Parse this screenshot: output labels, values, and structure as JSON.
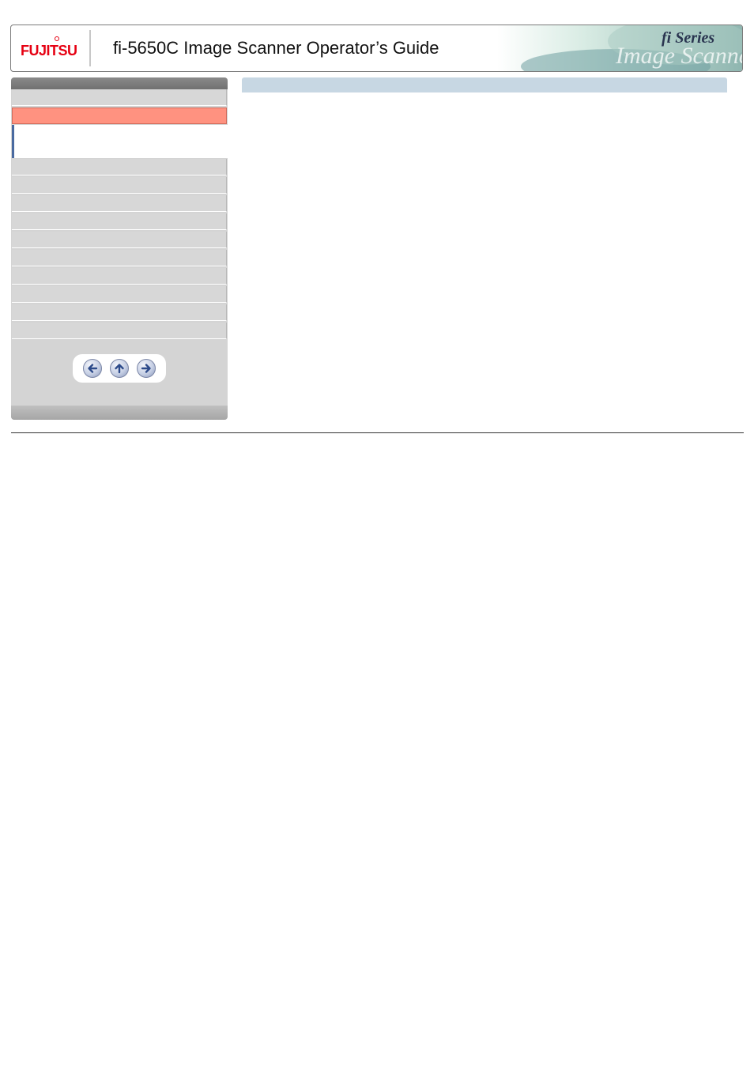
{
  "header": {
    "logo_text": "FUJITSU",
    "title": "fi-5650C Image Scanner Operator’s Guide",
    "series_badge": "fi Series",
    "banner_art_text": "Image Scanner"
  },
  "sidebar": {
    "item_count": 10,
    "active_index": 1,
    "nav_buttons": [
      {
        "icon": "arrow-left-icon",
        "label": "back"
      },
      {
        "icon": "arrow-up-icon",
        "label": "up"
      },
      {
        "icon": "arrow-right-icon",
        "label": "next"
      }
    ]
  },
  "colors": {
    "brand_red": "#e60012",
    "active_item": "#ff9280",
    "sidebar_bg": "#d4d4d4",
    "content_bar": "#c7d7e3",
    "accent_blue": "#4a6aa0"
  }
}
